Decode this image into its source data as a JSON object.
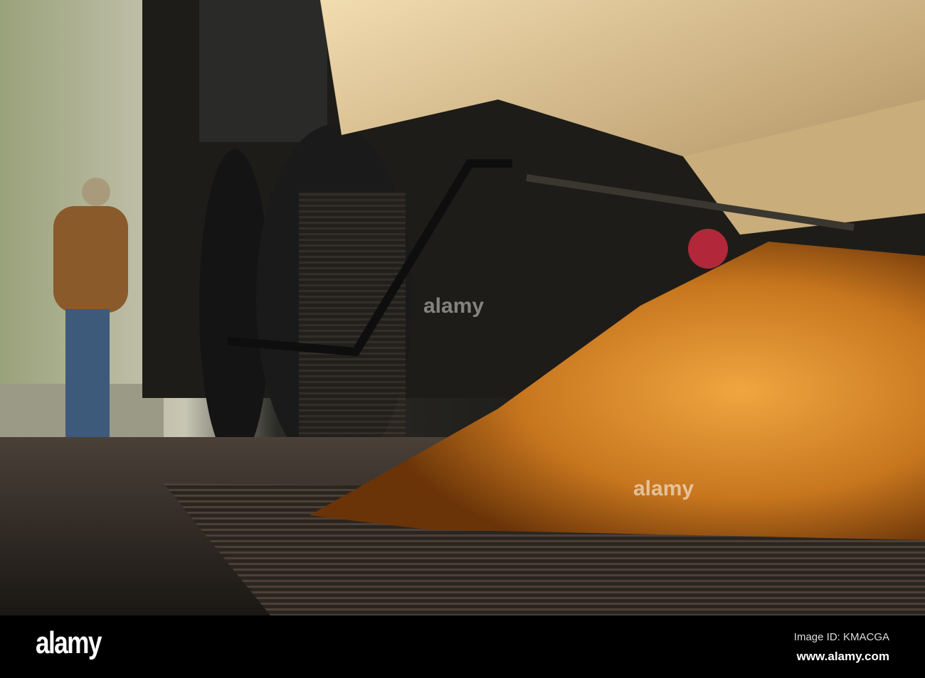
{
  "watermark": {
    "logo": "alamy",
    "overlay_text": "alamy"
  },
  "footer": {
    "logo": "alamy",
    "image_id": "Image ID: KMACGA",
    "url": "www.alamy.com"
  },
  "colors": {
    "grain": "#d98a2a",
    "grain_dark": "#7a3e0c",
    "truck_body": "#e3c99a",
    "background": "#000000"
  }
}
